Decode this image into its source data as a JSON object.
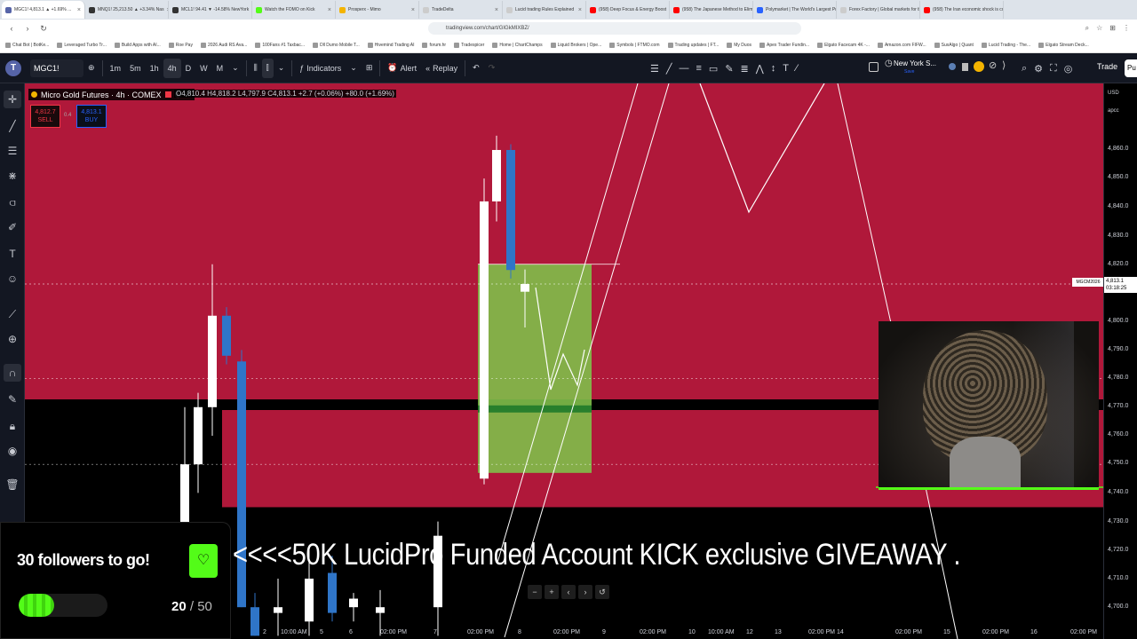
{
  "browser": {
    "tabs": [
      {
        "title": "MGC1! 4,813.1 ▲ +1.69% ...",
        "color": "#5664a8",
        "active": true
      },
      {
        "title": "MNQ1! 25,213.50 ▲ +3.34% Nas",
        "color": "#333333"
      },
      {
        "title": "MCL1! 94.41 ▼ -14.58% NewYork",
        "color": "#333333"
      },
      {
        "title": "Watch the FOMO on Kick",
        "color": "#53fc18"
      },
      {
        "title": "Prosperx - Mimo",
        "color": "#f4b400"
      },
      {
        "title": "TradeDelta",
        "color": "#cccccc"
      },
      {
        "title": "Lucid trading Rules Explained",
        "color": "#cccccc"
      },
      {
        "title": "(958) Deep Focus & Energy Boost",
        "color": "#ff0000"
      },
      {
        "title": "(958) The Japanese Method to Elimi",
        "color": "#ff0000"
      },
      {
        "title": "Polymarket | The World's Largest Pre",
        "color": "#2962ff"
      },
      {
        "title": "Forex Factory | Global markets for th",
        "color": "#cccccc"
      },
      {
        "title": "(958) The Iran economic shock is co",
        "color": "#ff0000"
      }
    ],
    "url": "tradingview.com/chart/GIGkMIXBZ/",
    "bookmarks": [
      "Chat Bot | BotKe...",
      "Leveraged Turbo Tr...",
      "Build Apps with AI...",
      "Roe Pay",
      "2026 Audi RS Ava...",
      "100Fans #1 Taxbac...",
      "Dll Dumo Mobile T...",
      "Hivemind Trading AI",
      "forum.hr",
      "Tradespicer",
      "Home | ChartChamps",
      "Liquid Brokers | Ope...",
      "Symbols | FTMO.com",
      "Trading updates | FT...",
      "My Duos",
      "Apex Trader Fundin...",
      "Elgato Facecam 4K -...",
      "Amazon.com FIFW...",
      "SuxAlgo | Quant",
      "Lucid Trading - The...",
      "Elgato Stream Deck..."
    ]
  },
  "toolbar": {
    "logo": "T",
    "symbol": "MGC1!",
    "intervals": [
      "1m",
      "5m",
      "1h",
      "4h",
      "D",
      "W",
      "M"
    ],
    "active_interval": "4h",
    "indicators_label": "Indicators",
    "alert_label": "Alert",
    "replay_label": "Replay",
    "timezone": "New York S...",
    "timezone_sub": "Save",
    "trade_label": "Trade",
    "publish_label": "Pu"
  },
  "legend": {
    "title": "Micro Gold Futures · 4h · COMEX",
    "ohlc": "O4,810.4 H4,818.2 L4,797.9 C4,813.1 +2.7 (+0.06%) +80.0 (+1.69%)",
    "sell_price": "4,812.7",
    "sell_label": "SELL",
    "spread": "0.4",
    "buy_price": "4,813.1",
    "buy_label": "BUY"
  },
  "price_axis": {
    "currency": "USD",
    "unit": "apcc",
    "labels": [
      "4,860.0",
      "4,850.0",
      "4,840.0",
      "4,830.0",
      "4,820.0",
      "4,800.0",
      "4,790.0",
      "4,780.0",
      "4,770.0",
      "4,760.0",
      "4,750.0",
      "4,740.0",
      "4,730.0",
      "4,720.0",
      "4,710.0",
      "4,700.0"
    ],
    "current_price": "4,813.1",
    "countdown": "03:18:25",
    "symbol_flag": "MGCM2026"
  },
  "time_axis": {
    "labels": [
      "2",
      "10:00 AM",
      "5",
      "6",
      "02:00 PM",
      "7",
      "02:00 PM",
      "8",
      "02:00 PM",
      "9",
      "02:00 PM",
      "10",
      "10:00 AM",
      "12",
      "13",
      "02:00 PM",
      "14",
      "02:00 PM",
      "15",
      "02:00 PM",
      "16",
      "02:00 PM"
    ]
  },
  "chart_data": {
    "type": "candlestick",
    "ylim": [
      4695,
      4870
    ],
    "candles": [
      {
        "o": 4690,
        "h": 4710,
        "l": 4690,
        "c": 4695,
        "dir": "up"
      },
      {
        "o": 4695,
        "h": 4770,
        "l": 4690,
        "c": 4750,
        "dir": "up"
      },
      {
        "o": 4750,
        "h": 4775,
        "l": 4740,
        "c": 4770,
        "dir": "up"
      },
      {
        "o": 4770,
        "h": 4820,
        "l": 4760,
        "c": 4802,
        "dir": "up"
      },
      {
        "o": 4802,
        "h": 4805,
        "l": 4785,
        "c": 4788,
        "dir": "down"
      },
      {
        "o": 4786,
        "h": 4790,
        "l": 4700,
        "c": 4700,
        "dir": "down"
      },
      {
        "o": 4700,
        "h": 4705,
        "l": 4690,
        "c": 4690,
        "dir": "down"
      },
      {
        "o": 4700,
        "h": 4710,
        "l": 4690,
        "c": 4698,
        "dir": "up"
      },
      {
        "o": 4695,
        "h": 4720,
        "l": 4690,
        "c": 4710,
        "dir": "up"
      },
      {
        "o": 4712,
        "h": 4718,
        "l": 4695,
        "c": 4698,
        "dir": "down"
      },
      {
        "o": 4700,
        "h": 4705,
        "l": 4695,
        "c": 4703,
        "dir": "up"
      },
      {
        "o": 4698,
        "h": 4706,
        "l": 4690,
        "c": 4700,
        "dir": "up"
      },
      {
        "o": 4700,
        "h": 4730,
        "l": 4690,
        "c": 4725,
        "dir": "up"
      },
      {
        "o": 4745,
        "h": 4850,
        "l": 4743,
        "c": 4842,
        "dir": "up"
      },
      {
        "o": 4842,
        "h": 4865,
        "l": 4835,
        "c": 4860,
        "dir": "up"
      },
      {
        "o": 4860,
        "h": 4862,
        "l": 4815,
        "c": 4818,
        "dir": "down"
      },
      {
        "o": 4810.4,
        "h": 4818.2,
        "l": 4797.9,
        "c": 4813.1,
        "dir": "up"
      }
    ],
    "zones": [
      {
        "name": "supply",
        "from": 4735,
        "to": 4875,
        "color": "#b0183a"
      },
      {
        "name": "demand",
        "from": 4747,
        "to": 4820,
        "color": "#7fbf4a"
      }
    ],
    "levels": [
      4813.1,
      4780,
      4750,
      4770
    ]
  },
  "overlay": {
    "followers_text": "30 followers to go!",
    "current": "20",
    "total": "50",
    "progress": 0.4,
    "giveaway": "<<<<50K LucidPro Funded Account KICK exclusive GIVEAWAY ."
  }
}
